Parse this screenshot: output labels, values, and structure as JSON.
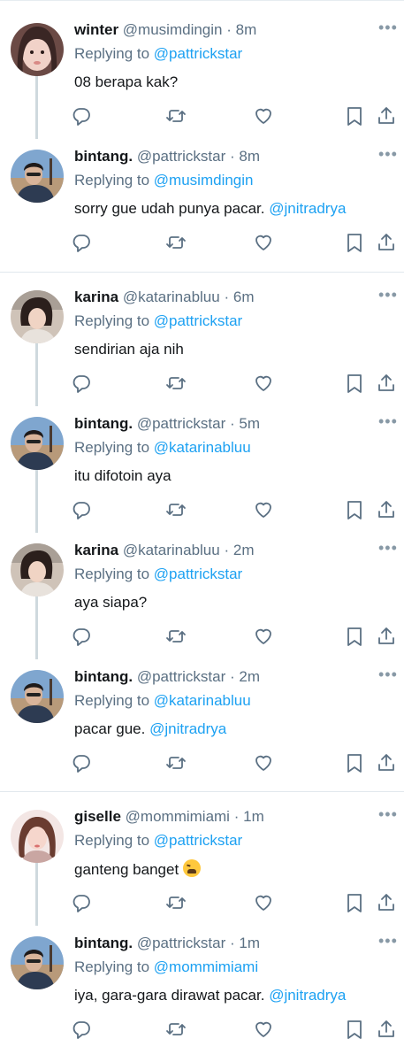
{
  "tweets": [
    {
      "name": "winter",
      "handle": "@musimdingin",
      "dot": "·",
      "time": "8m",
      "replying_label": "Replying to",
      "replying_to": "@pattrickstar",
      "text": "08 berapa kak?",
      "mention": "",
      "avatar": "winter"
    },
    {
      "name": "bintang.",
      "handle": "@pattrickstar",
      "dot": "·",
      "time": "8m",
      "replying_label": "Replying to",
      "replying_to": "@musimdingin",
      "text": "sorry gue udah punya pacar.",
      "mention": "@jnitradrya",
      "avatar": "bintang"
    },
    {
      "name": "karina",
      "handle": "@katarinabluu",
      "dot": "·",
      "time": "6m",
      "replying_label": "Replying to",
      "replying_to": "@pattrickstar",
      "text": "sendirian aja nih",
      "mention": "",
      "avatar": "karina"
    },
    {
      "name": "bintang.",
      "handle": "@pattrickstar",
      "dot": "·",
      "time": "5m",
      "replying_label": "Replying to",
      "replying_to": "@katarinabluu",
      "text": "itu difotoin aya",
      "mention": "",
      "avatar": "bintang"
    },
    {
      "name": "karina",
      "handle": "@katarinabluu",
      "dot": "·",
      "time": "2m",
      "replying_label": "Replying to",
      "replying_to": "@pattrickstar",
      "text": "aya siapa?",
      "mention": "",
      "avatar": "karina"
    },
    {
      "name": "bintang.",
      "handle": "@pattrickstar",
      "dot": "·",
      "time": "2m",
      "replying_label": "Replying to",
      "replying_to": "@katarinabluu",
      "text": "pacar gue.",
      "mention": "@jnitradrya",
      "avatar": "bintang"
    },
    {
      "name": "giselle",
      "handle": "@mommimiami",
      "dot": "·",
      "time": "1m",
      "replying_label": "Replying to",
      "replying_to": "@pattrickstar",
      "text": "ganteng banget",
      "mention": "",
      "avatar": "giselle",
      "emoji": "tired-face-emoji"
    },
    {
      "name": "bintang.",
      "handle": "@pattrickstar",
      "dot": "·",
      "time": "1m",
      "replying_label": "Replying to",
      "replying_to": "@mommimiami",
      "text": "iya, gara-gara dirawat pacar.",
      "mention": "@jnitradrya",
      "avatar": "bintang"
    }
  ],
  "more_glyph": "•••",
  "icons": {
    "reply": "reply-icon",
    "retweet": "retweet-icon",
    "like": "heart-icon",
    "bookmark": "bookmark-icon",
    "share": "share-icon",
    "more": "more-icon"
  },
  "colors": {
    "mention": "#1da1f2",
    "secondary": "#5b7083",
    "thread_line": "#cfd9de"
  }
}
